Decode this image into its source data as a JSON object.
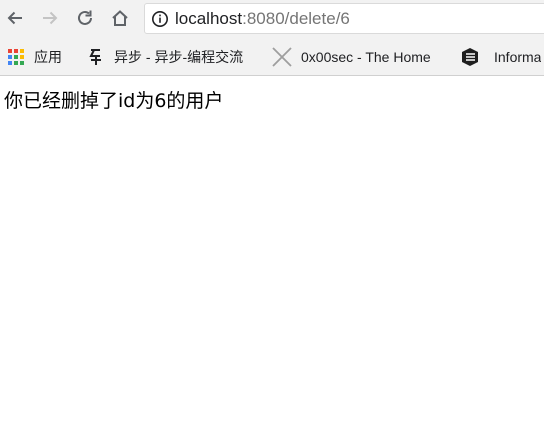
{
  "browser": {
    "address_bar": {
      "host": "localhost",
      "port_and_path": ":8080/delete/6"
    },
    "bookmarks": [
      {
        "label": "应用",
        "icon": "apps-grid-icon"
      },
      {
        "label": "异步 - 异步-编程交流",
        "icon": "yibu-logo-icon"
      },
      {
        "label": "0x00sec - The Home",
        "icon": "x-logo-icon"
      },
      {
        "label": "Informa",
        "icon": "stacked-logo-icon"
      }
    ]
  },
  "page": {
    "message": "你已经删掉了id为6的用户"
  }
}
